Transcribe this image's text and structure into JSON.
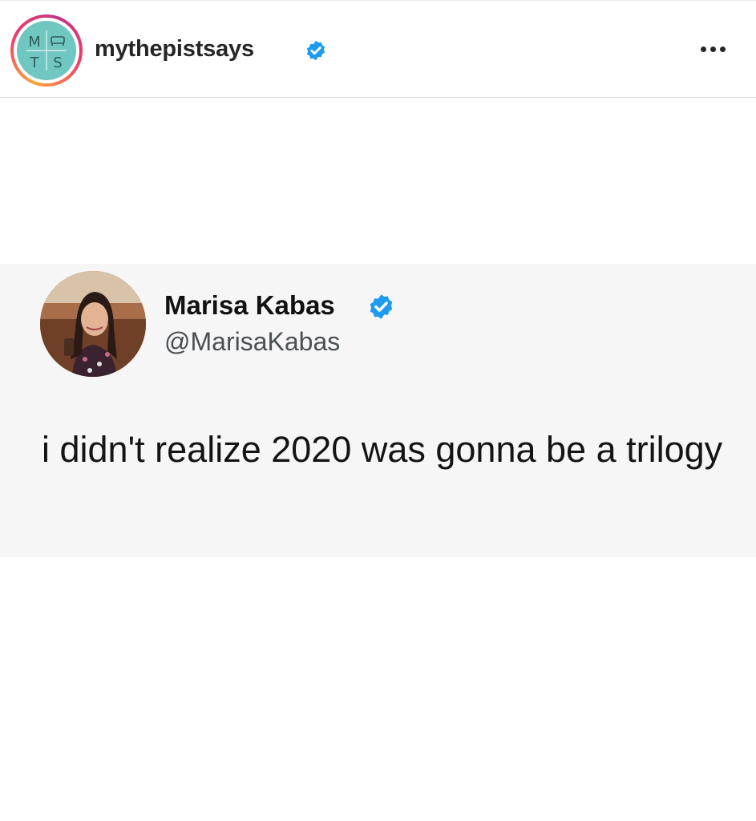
{
  "post": {
    "username": "mythepistsays",
    "avatar_text": {
      "top_left": "M",
      "bottom_left": "T",
      "bottom_right": "S"
    }
  },
  "tweet": {
    "display_name": "Marisa Kabas",
    "handle": "@MarisaKabas",
    "text": "i didn't realize 2020 was gonna be a trilogy"
  },
  "icons": {
    "verified": "verified-badge-icon",
    "more": "more-options-icon"
  },
  "colors": {
    "verified_blue": "#1d9bf0",
    "avatar_teal": "#70c6c1",
    "tweet_background": "#f6f6f6"
  }
}
